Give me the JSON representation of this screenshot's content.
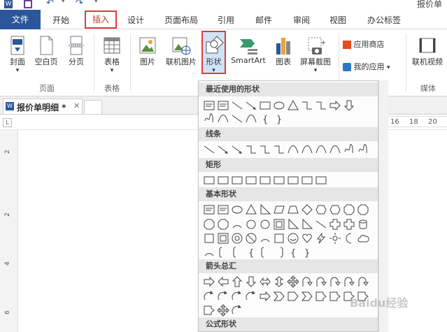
{
  "title_partial": "报价单",
  "menu": {
    "file": "文件",
    "tabs": [
      "开始",
      "插入",
      "设计",
      "页面布局",
      "引用",
      "邮件",
      "审阅",
      "视图",
      "办公标签"
    ]
  },
  "ribbon": {
    "buttons": [
      "封面",
      "空白页",
      "分页",
      "表格",
      "图片",
      "联机图片",
      "形状",
      "SmartArt",
      "图表",
      "屏幕截图",
      "应用商店",
      "我的应用",
      "联机视频"
    ],
    "groups": [
      "页面",
      "表格",
      "媒体"
    ],
    "dropdown_arrow": "▾"
  },
  "doc_tab": {
    "name": "报价单明细 *",
    "close": "✕"
  },
  "ruler": {
    "numbers": [
      "16",
      "18",
      "20"
    ],
    "vnumbers": [
      "2",
      "2",
      "4",
      "6"
    ]
  },
  "shapes_menu": {
    "sections": [
      "最近使用的形状",
      "线条",
      "矩形",
      "基本形状",
      "箭头总汇",
      "公式形状"
    ]
  },
  "brace_glyphs": [
    "{",
    "}",
    "[",
    "]",
    "{",
    "}"
  ],
  "watermark": "Baidu经验"
}
